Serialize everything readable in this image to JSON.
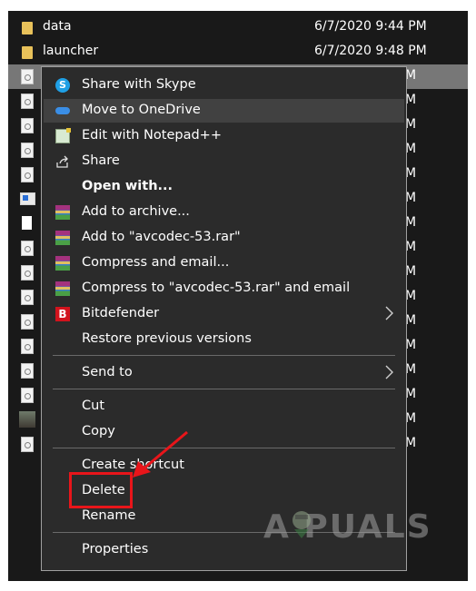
{
  "files": [
    {
      "name": "data",
      "date": "6/7/2020 9:44 PM",
      "icon": "folder-icon"
    },
    {
      "name": "launcher",
      "date": "6/7/2020 9:48 PM",
      "icon": "folder-icon"
    }
  ],
  "partial_dates": [
    "M",
    "M",
    "M",
    "M",
    "M",
    "M",
    "M",
    "M",
    "M",
    "M",
    "M",
    "M",
    "M",
    "M",
    "M",
    "M"
  ],
  "menu": {
    "items": [
      {
        "label": "Share with Skype",
        "icon": "skype-icon"
      },
      {
        "label": "Move to OneDrive",
        "icon": "onedrive-icon"
      },
      {
        "label": "Edit with Notepad++",
        "icon": "notepad-icon"
      },
      {
        "label": "Share",
        "icon": "share-icon"
      },
      {
        "label": "Open with...",
        "icon": ""
      },
      {
        "label": "Add to archive...",
        "icon": "winrar-icon"
      },
      {
        "label": "Add to \"avcodec-53.rar\"",
        "icon": "winrar-icon"
      },
      {
        "label": "Compress and email...",
        "icon": "winrar-icon"
      },
      {
        "label": "Compress to \"avcodec-53.rar\" and email",
        "icon": "winrar-icon"
      },
      {
        "label": "Bitdefender",
        "icon": "bitdefender-icon"
      },
      {
        "label": "Restore previous versions",
        "icon": ""
      },
      {
        "label": "Send to",
        "icon": ""
      },
      {
        "label": "Cut",
        "icon": ""
      },
      {
        "label": "Copy",
        "icon": ""
      },
      {
        "label": "Create shortcut",
        "icon": ""
      },
      {
        "label": "Delete",
        "icon": ""
      },
      {
        "label": "Rename",
        "icon": ""
      },
      {
        "label": "Properties",
        "icon": ""
      }
    ]
  },
  "watermark": "A PUALS",
  "colors": {
    "background": "#191919",
    "menu_bg": "#2b2b2b",
    "hover": "#414141",
    "selected_row": "#777777",
    "annotation_red": "#e8151a"
  }
}
